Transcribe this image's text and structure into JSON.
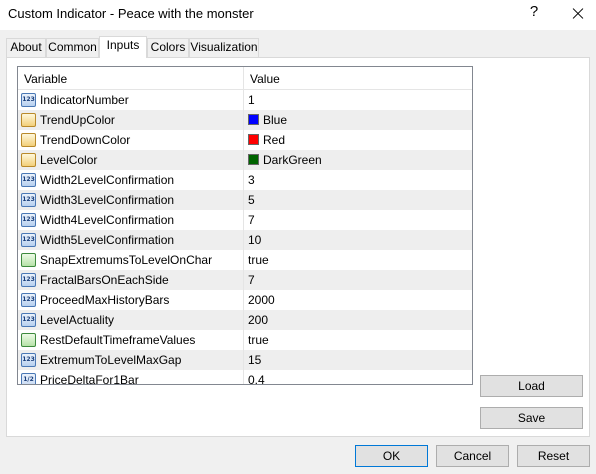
{
  "window": {
    "title": "Custom Indicator - Peace with the monster",
    "help_glyph": "?"
  },
  "tabs": [
    {
      "label": "About",
      "active": false
    },
    {
      "label": "Common",
      "active": false
    },
    {
      "label": "Inputs",
      "active": true
    },
    {
      "label": "Colors",
      "active": false
    },
    {
      "label": "Visualization",
      "active": false
    }
  ],
  "grid": {
    "header": {
      "variable": "Variable",
      "value": "Value"
    },
    "rows": [
      {
        "icon": "integer-icon",
        "name": "IndicatorNumber",
        "value": "1"
      },
      {
        "icon": "color-icon",
        "name": "TrendUpColor",
        "value": "Blue",
        "swatch": "#0000ff"
      },
      {
        "icon": "color-icon",
        "name": "TrendDownColor",
        "value": "Red",
        "swatch": "#ff0000"
      },
      {
        "icon": "color-icon",
        "name": "LevelColor",
        "value": "DarkGreen",
        "swatch": "#006400"
      },
      {
        "icon": "integer-icon",
        "name": "Width2LevelConfirmation",
        "value": "3"
      },
      {
        "icon": "integer-icon",
        "name": "Width3LevelConfirmation",
        "value": "5"
      },
      {
        "icon": "integer-icon",
        "name": "Width4LevelConfirmation",
        "value": "7"
      },
      {
        "icon": "integer-icon",
        "name": "Width5LevelConfirmation",
        "value": "10"
      },
      {
        "icon": "bool-icon",
        "name": "SnapExtremumsToLevelOnChar",
        "value": "true"
      },
      {
        "icon": "integer-icon",
        "name": "FractalBarsOnEachSide",
        "value": "7"
      },
      {
        "icon": "integer-icon",
        "name": "ProceedMaxHistoryBars",
        "value": "2000"
      },
      {
        "icon": "integer-icon",
        "name": "LevelActuality",
        "value": "200"
      },
      {
        "icon": "bool-icon",
        "name": "RestDefaultTimeframeValues",
        "value": "true"
      },
      {
        "icon": "integer-icon",
        "name": "ExtremumToLevelMaxGap",
        "value": "15"
      },
      {
        "icon": "double-icon",
        "name": "PriceDeltaFor1Bar",
        "value": "0.4"
      }
    ]
  },
  "side_buttons": {
    "load": "Load",
    "save": "Save"
  },
  "footer_buttons": {
    "ok": "OK",
    "cancel": "Cancel",
    "reset": "Reset"
  }
}
